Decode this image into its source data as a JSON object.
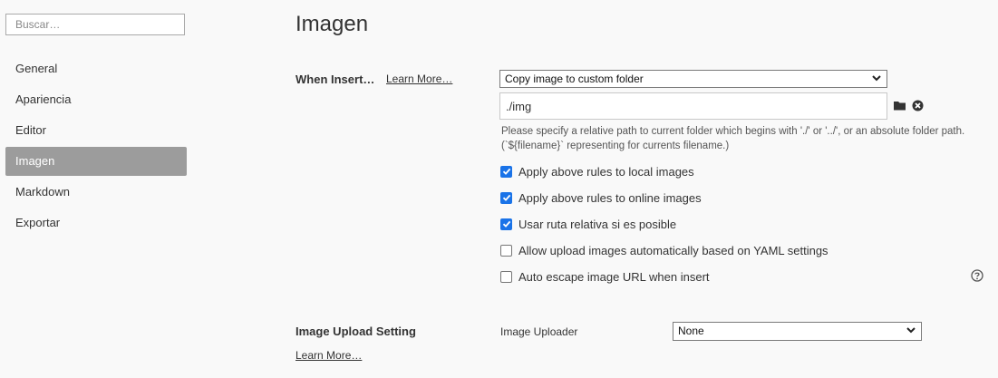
{
  "sidebar": {
    "search_placeholder": "Buscar…",
    "items": [
      {
        "label": "General"
      },
      {
        "label": "Apariencia"
      },
      {
        "label": "Editor"
      },
      {
        "label": "Imagen",
        "active": true
      },
      {
        "label": "Markdown"
      },
      {
        "label": "Exportar"
      }
    ]
  },
  "main": {
    "title": "Imagen",
    "when_insert": {
      "label": "When Insert…",
      "learn_more": "Learn More…",
      "select_value": "Copy image to custom folder",
      "path_value": "./img",
      "hint": "Please specify a relative path to current folder which begins with './' or '../', or an absolute folder path. (`${filename}` representing for currents filename.)"
    },
    "checkboxes": [
      {
        "label": "Apply above rules to local images",
        "checked": true
      },
      {
        "label": "Apply above rules to online images",
        "checked": true
      },
      {
        "label": "Usar ruta relativa si es posible",
        "checked": true
      },
      {
        "label": "Allow upload images automatically based on YAML settings",
        "checked": false
      },
      {
        "label": "Auto escape image URL when insert",
        "checked": false
      }
    ],
    "upload": {
      "label": "Image Upload Setting",
      "learn_more": "Learn More…",
      "uploader_label": "Image Uploader",
      "uploader_value": "None"
    }
  },
  "colors": {
    "accent": "#1a73e8",
    "active_nav_bg": "#9c9c9c",
    "background": "#f9f9f9"
  },
  "icons": [
    "folder-icon",
    "clear-icon",
    "help-icon",
    "chevron-down-icon",
    "checkmark-icon"
  ]
}
